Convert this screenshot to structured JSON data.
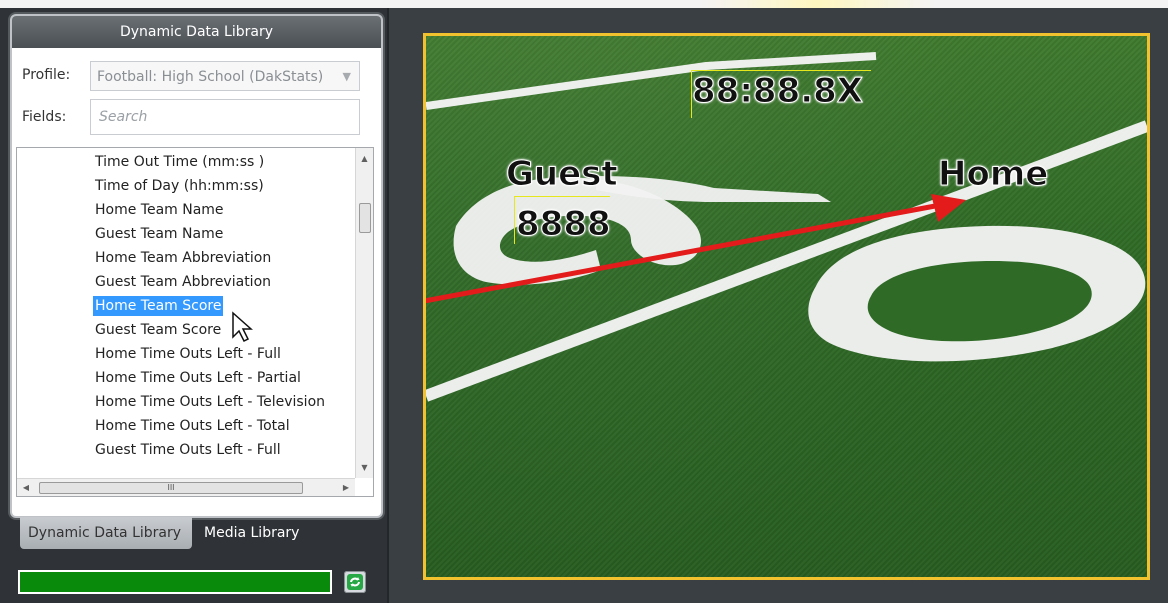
{
  "app": {
    "panel_title": "Dynamic Data Library"
  },
  "profile": {
    "label": "Profile:",
    "value": "Football: High School (DakStats)"
  },
  "fields": {
    "label": "Fields:",
    "placeholder": "Search"
  },
  "list": {
    "items": [
      "Time Out Time (mm:ss  )",
      "Time of Day (hh:mm:ss)",
      "Home Team Name",
      "Guest Team Name",
      "Home Team Abbreviation",
      "Guest Team Abbreviation",
      "Home Team Score",
      "Guest Team Score",
      "Home Time Outs Left - Full",
      "Home Time Outs Left - Partial",
      "Home Time Outs Left - Television",
      "Home Time Outs Left - Total",
      "Guest Time Outs Left - Full"
    ],
    "selected_index": 6,
    "scrollbar_h_label": "III"
  },
  "tabs": {
    "dynamic_label": "Dynamic Data Library",
    "media_label": "Media Library"
  },
  "preview": {
    "clock": "88:88.8X",
    "guest": "Guest",
    "guest_score": "8888",
    "home": "Home"
  },
  "colors": {
    "selection": "#3399ff",
    "preview_border": "#f2c12e",
    "progress": "#007a00",
    "arrow": "#e31b1b"
  },
  "progress": {
    "value": 1.0
  },
  "icons": {
    "refresh": "refresh-icon",
    "dropdown": "chevron-down-icon",
    "pointer": "cursor-arrow-icon"
  }
}
